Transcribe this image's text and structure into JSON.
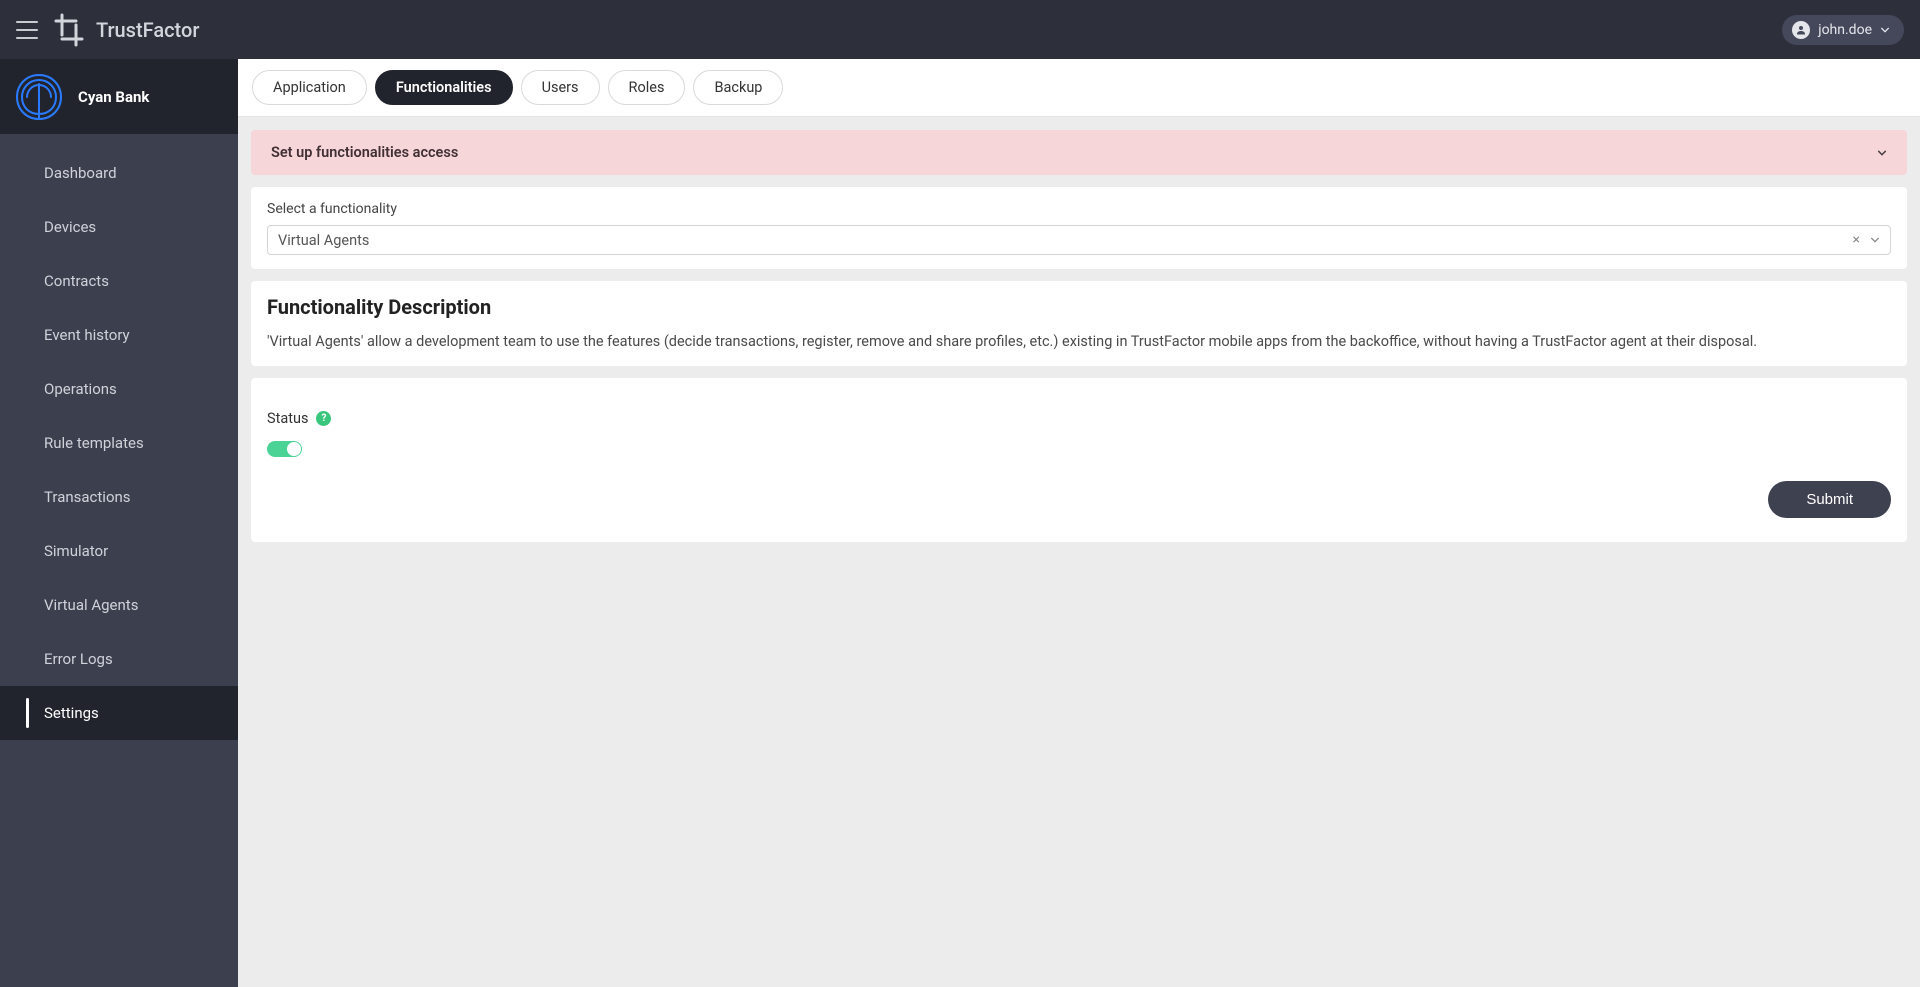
{
  "header": {
    "app_title": "TrustFactor",
    "user_name": "john.doe"
  },
  "sidebar": {
    "org_name": "Cyan Bank",
    "items": [
      {
        "label": "Dashboard"
      },
      {
        "label": "Devices"
      },
      {
        "label": "Contracts"
      },
      {
        "label": "Event history"
      },
      {
        "label": "Operations"
      },
      {
        "label": "Rule templates"
      },
      {
        "label": "Transactions"
      },
      {
        "label": "Simulator"
      },
      {
        "label": "Virtual Agents"
      },
      {
        "label": "Error Logs"
      },
      {
        "label": "Settings"
      }
    ],
    "active_index": 10
  },
  "tabs": {
    "items": [
      "Application",
      "Functionalities",
      "Users",
      "Roles",
      "Backup"
    ],
    "active_index": 1
  },
  "notice": {
    "text": "Set up functionalities access"
  },
  "selector": {
    "label": "Select a functionality",
    "value": "Virtual Agents"
  },
  "description": {
    "heading": "Functionality Description",
    "body": "'Virtual Agents' allow a development team to use the features (decide transactions, register, remove and share profiles, etc.) existing in TrustFactor mobile apps from the backoffice, without having a TrustFactor agent at their disposal."
  },
  "status": {
    "label": "Status",
    "enabled": true
  },
  "actions": {
    "submit": "Submit"
  },
  "colors": {
    "topbar": "#2d2f3a",
    "sidebar": "#3c3f4d",
    "accent_green": "#4bd396",
    "notice_bg": "#f7d6da"
  }
}
